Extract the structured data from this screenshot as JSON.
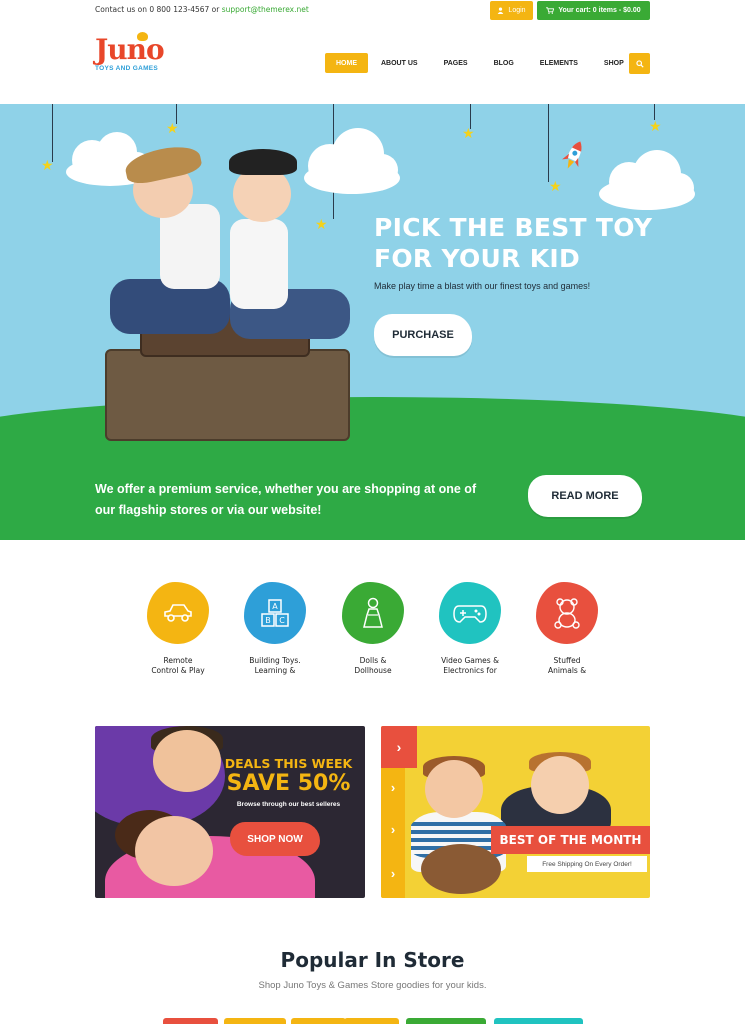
{
  "topbar": {
    "contact_prefix": "Contact us on 0 800 123-4567 or",
    "email": "support@themerex.net",
    "login_label": "Login",
    "cart_label": "Your cart: 0 items - $0.00"
  },
  "header": {
    "logo_name": "Juno",
    "logo_tagline": "TOYS AND GAMES",
    "nav": [
      "HOME",
      "ABOUT US",
      "PAGES",
      "BLOG",
      "ELEMENTS",
      "SHOP"
    ],
    "active_nav": "HOME"
  },
  "hero": {
    "title_line1": "PICK THE BEST TOY",
    "title_line2": "FOR YOUR KID",
    "subtitle": "Make play time a blast with our finest toys and games!",
    "purchase_label": "PURCHASE",
    "bottom_line1": "We offer a premium service, whether you are shopping at one of",
    "bottom_line2": "our flagship stores or via our website!",
    "readmore_label": "READ MORE"
  },
  "categories": [
    {
      "line1": "Remote",
      "line2": "Control & Play",
      "color": "#f4b512",
      "icon": "car-icon"
    },
    {
      "line1": "Building Toys.",
      "line2": "Learning &",
      "color": "#2e9fd8",
      "icon": "blocks-icon"
    },
    {
      "line1": "Dolls &",
      "line2": "Dollhouse",
      "color": "#3aaa35",
      "icon": "doll-icon"
    },
    {
      "line1": "Video Games &",
      "line2": "Electronics for",
      "color": "#20c3c0",
      "icon": "gamepad-icon"
    },
    {
      "line1": "Stuffed",
      "line2": "Animals &",
      "color": "#e8503e",
      "icon": "teddy-bear-icon"
    }
  ],
  "promo_left": {
    "line1": "DEALS THIS WEEK",
    "line2": "SAVE 50%",
    "line3": "Browse through our best selleres",
    "button": "SHOP NOW"
  },
  "promo_right": {
    "title": "BEST OF THE MONTH",
    "subtitle": "Free Shipping On Every Order!"
  },
  "popular": {
    "title": "Popular In Store",
    "subtitle": "Shop Juno Toys & Games Store goodies for your kids."
  },
  "colors": {
    "yellow": "#f4b512",
    "green": "#3aaa35",
    "red": "#e8503e",
    "sky": "#8fd2e8"
  }
}
